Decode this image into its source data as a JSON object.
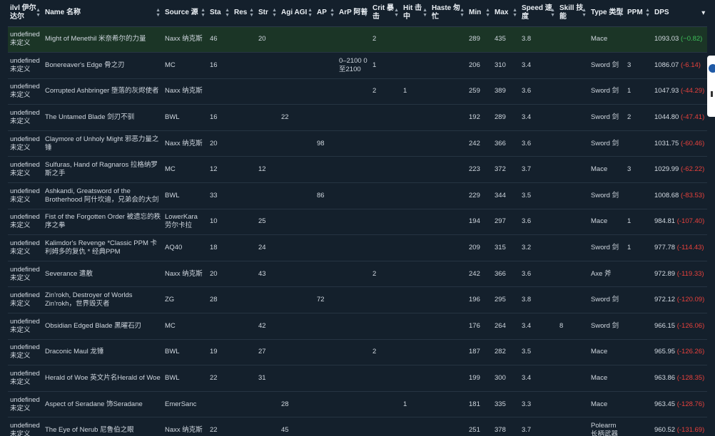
{
  "columns": [
    {
      "key": "ilvl",
      "label": "ilvl 伊尔达尔",
      "w": 49
    },
    {
      "key": "name",
      "label": "Name 名称",
      "w": 168
    },
    {
      "key": "source",
      "label": "Source 源",
      "w": 63
    },
    {
      "key": "sta",
      "label": "Sta",
      "w": 34
    },
    {
      "key": "res",
      "label": "Res",
      "w": 34
    },
    {
      "key": "str",
      "label": "Str",
      "w": 32
    },
    {
      "key": "agi",
      "label": "Agi AGI",
      "w": 50
    },
    {
      "key": "ap",
      "label": "AP",
      "w": 31
    },
    {
      "key": "arp",
      "label": "ArP 阿普",
      "w": 47
    },
    {
      "key": "crit",
      "label": "Crit 暴击",
      "w": 43
    },
    {
      "key": "hit",
      "label": "Hit 击中",
      "w": 40
    },
    {
      "key": "haste",
      "label": "Haste 匆忙",
      "w": 52
    },
    {
      "key": "min",
      "label": "Min",
      "w": 36
    },
    {
      "key": "max",
      "label": "Max",
      "w": 38
    },
    {
      "key": "speed",
      "label": "Speed 速度",
      "w": 53
    },
    {
      "key": "skill",
      "label": "Skill 技能",
      "w": 44
    },
    {
      "key": "type",
      "label": "Type 类型",
      "w": 51
    },
    {
      "key": "ppm",
      "label": "PPM",
      "w": 38
    },
    {
      "key": "dps",
      "label": "DPS",
      "w": 77
    }
  ],
  "rows": [
    {
      "ilvl": "undefined 未定义",
      "name": "Might of Menethil 米奈希尔的力量",
      "source": "Naxx 纳克斯",
      "sta": "46",
      "res": "",
      "str": "20",
      "agi": "",
      "ap": "",
      "arp": "",
      "crit": "2",
      "hit": "",
      "haste": "",
      "min": "289",
      "max": "435",
      "speed": "3.8",
      "skill": "",
      "type": "Mace",
      "ppm": "",
      "dps": "1093.03",
      "diff": "(−0.82)",
      "diff_sign": "pos"
    },
    {
      "ilvl": "undefined 未定义",
      "name": "Bonereaver's Edge 骨之刃",
      "source": "MC",
      "sta": "16",
      "res": "",
      "str": "",
      "agi": "",
      "ap": "",
      "arp": "0–2100 0至2100",
      "crit": "1",
      "hit": "",
      "haste": "",
      "min": "206",
      "max": "310",
      "speed": "3.4",
      "skill": "",
      "type": "Sword 剑",
      "ppm": "3",
      "dps": "1086.07",
      "diff": "(-6.14)",
      "diff_sign": "neg"
    },
    {
      "ilvl": "undefined 未定义",
      "name": "Corrupted Ashbringer 堕落的灰烬使者",
      "source": "Naxx 纳克斯",
      "sta": "",
      "res": "",
      "str": "",
      "agi": "",
      "ap": "",
      "arp": "",
      "crit": "2",
      "hit": "1",
      "haste": "",
      "min": "259",
      "max": "389",
      "speed": "3.6",
      "skill": "",
      "type": "Sword 剑",
      "ppm": "1",
      "dps": "1047.93",
      "diff": "(-44.29)",
      "diff_sign": "neg"
    },
    {
      "ilvl": "undefined 未定义",
      "name": "The Untamed Blade 剑刃不驯",
      "source": "BWL",
      "sta": "16",
      "res": "",
      "str": "",
      "agi": "22",
      "ap": "",
      "arp": "",
      "crit": "",
      "hit": "",
      "haste": "",
      "min": "192",
      "max": "289",
      "speed": "3.4",
      "skill": "",
      "type": "Sword 剑",
      "ppm": "2",
      "dps": "1044.80",
      "diff": "(-47.41)",
      "diff_sign": "neg"
    },
    {
      "ilvl": "undefined 未定义",
      "name": "Claymore of Unholy Might 邪恶力量之锤",
      "source": "Naxx 纳克斯",
      "sta": "20",
      "res": "",
      "str": "",
      "agi": "",
      "ap": "98",
      "arp": "",
      "crit": "",
      "hit": "",
      "haste": "",
      "min": "242",
      "max": "366",
      "speed": "3.6",
      "skill": "",
      "type": "Sword 剑",
      "ppm": "",
      "dps": "1031.75",
      "diff": "(-60.46)",
      "diff_sign": "neg"
    },
    {
      "ilvl": "undefined 未定义",
      "name": "Sulfuras, Hand of Ragnaros 拉格纳罗斯之手",
      "source": "MC",
      "sta": "12",
      "res": "",
      "str": "12",
      "agi": "",
      "ap": "",
      "arp": "",
      "crit": "",
      "hit": "",
      "haste": "",
      "min": "223",
      "max": "372",
      "speed": "3.7",
      "skill": "",
      "type": "Mace",
      "ppm": "3",
      "dps": "1029.99",
      "diff": "(-62.22)",
      "diff_sign": "neg"
    },
    {
      "ilvl": "undefined 未定义",
      "name": "Ashkandi, Greatsword of the Brotherhood 阿什坎迪，兄弟会的大剑",
      "source": "BWL",
      "sta": "33",
      "res": "",
      "str": "",
      "agi": "",
      "ap": "86",
      "arp": "",
      "crit": "",
      "hit": "",
      "haste": "",
      "min": "229",
      "max": "344",
      "speed": "3.5",
      "skill": "",
      "type": "Sword 剑",
      "ppm": "",
      "dps": "1008.68",
      "diff": "(-83.53)",
      "diff_sign": "neg"
    },
    {
      "ilvl": "undefined 未定义",
      "name": "Fist of the Forgotten Order 被遗忘的秩序之拳",
      "source": "LowerKara 劳尔卡拉",
      "sta": "10",
      "res": "",
      "str": "25",
      "agi": "",
      "ap": "",
      "arp": "",
      "crit": "",
      "hit": "",
      "haste": "",
      "min": "194",
      "max": "297",
      "speed": "3.6",
      "skill": "",
      "type": "Mace",
      "ppm": "1",
      "dps": "984.81",
      "diff": "(-107.40)",
      "diff_sign": "neg"
    },
    {
      "ilvl": "undefined 未定义",
      "name": "Kalimdor's Revenge *Classic PPM 卡利姆多的复仇 * 经典PPM",
      "source": "AQ40",
      "sta": "18",
      "res": "",
      "str": "24",
      "agi": "",
      "ap": "",
      "arp": "",
      "crit": "",
      "hit": "",
      "haste": "",
      "min": "209",
      "max": "315",
      "speed": "3.2",
      "skill": "",
      "type": "Sword 剑",
      "ppm": "1",
      "dps": "977.78",
      "diff": "(-114.43)",
      "diff_sign": "neg"
    },
    {
      "ilvl": "undefined 未定义",
      "name": "Severance 遣散",
      "source": "Naxx 纳克斯",
      "sta": "20",
      "res": "",
      "str": "43",
      "agi": "",
      "ap": "",
      "arp": "",
      "crit": "2",
      "hit": "",
      "haste": "",
      "min": "242",
      "max": "366",
      "speed": "3.6",
      "skill": "",
      "type": "Axe 斧",
      "ppm": "",
      "dps": "972.89",
      "diff": "(-119.33)",
      "diff_sign": "neg"
    },
    {
      "ilvl": "undefined 未定义",
      "name": "Zin'rokh, Destroyer of Worlds Zin'rokh，世界毁灭者",
      "source": "ZG",
      "sta": "28",
      "res": "",
      "str": "",
      "agi": "",
      "ap": "72",
      "arp": "",
      "crit": "",
      "hit": "",
      "haste": "",
      "min": "196",
      "max": "295",
      "speed": "3.8",
      "skill": "",
      "type": "Sword 剑",
      "ppm": "",
      "dps": "972.12",
      "diff": "(-120.09)",
      "diff_sign": "neg"
    },
    {
      "ilvl": "undefined 未定义",
      "name": "Obsidian Edged Blade 黑曜石刃",
      "source": "MC",
      "sta": "",
      "res": "",
      "str": "42",
      "agi": "",
      "ap": "",
      "arp": "",
      "crit": "",
      "hit": "",
      "haste": "",
      "min": "176",
      "max": "264",
      "speed": "3.4",
      "skill": "8",
      "type": "Sword 剑",
      "ppm": "",
      "dps": "966.15",
      "diff": "(-126.06)",
      "diff_sign": "neg"
    },
    {
      "ilvl": "undefined 未定义",
      "name": "Draconic Maul 龙锤",
      "source": "BWL",
      "sta": "19",
      "res": "",
      "str": "27",
      "agi": "",
      "ap": "",
      "arp": "",
      "crit": "2",
      "hit": "",
      "haste": "",
      "min": "187",
      "max": "282",
      "speed": "3.5",
      "skill": "",
      "type": "Mace",
      "ppm": "",
      "dps": "965.95",
      "diff": "(-126.26)",
      "diff_sign": "neg"
    },
    {
      "ilvl": "undefined 未定义",
      "name": "Herald of Woe 英文片名Herald of Woe",
      "source": "BWL",
      "sta": "22",
      "res": "",
      "str": "31",
      "agi": "",
      "ap": "",
      "arp": "",
      "crit": "",
      "hit": "",
      "haste": "",
      "min": "199",
      "max": "300",
      "speed": "3.4",
      "skill": "",
      "type": "Mace",
      "ppm": "",
      "dps": "963.86",
      "diff": "(-128.35)",
      "diff_sign": "neg"
    },
    {
      "ilvl": "undefined 未定义",
      "name": "Aspect of Seradane 饰Seradane",
      "source": "EmerSanc",
      "sta": "",
      "res": "",
      "str": "",
      "agi": "28",
      "ap": "",
      "arp": "",
      "crit": "",
      "hit": "1",
      "haste": "",
      "min": "181",
      "max": "335",
      "speed": "3.3",
      "skill": "",
      "type": "Mace",
      "ppm": "",
      "dps": "963.45",
      "diff": "(-128.76)",
      "diff_sign": "neg"
    },
    {
      "ilvl": "undefined 未定义",
      "name": "The Eye of Nerub 尼鲁伯之眼",
      "source": "Naxx 纳克斯",
      "sta": "22",
      "res": "",
      "str": "",
      "agi": "45",
      "ap": "",
      "arp": "",
      "crit": "",
      "hit": "",
      "haste": "",
      "min": "251",
      "max": "378",
      "speed": "3.7",
      "skill": "",
      "type": "Polearm 长柄武器",
      "ppm": "",
      "dps": "960.52",
      "diff": "(-131.69)",
      "diff_sign": "neg"
    }
  ]
}
